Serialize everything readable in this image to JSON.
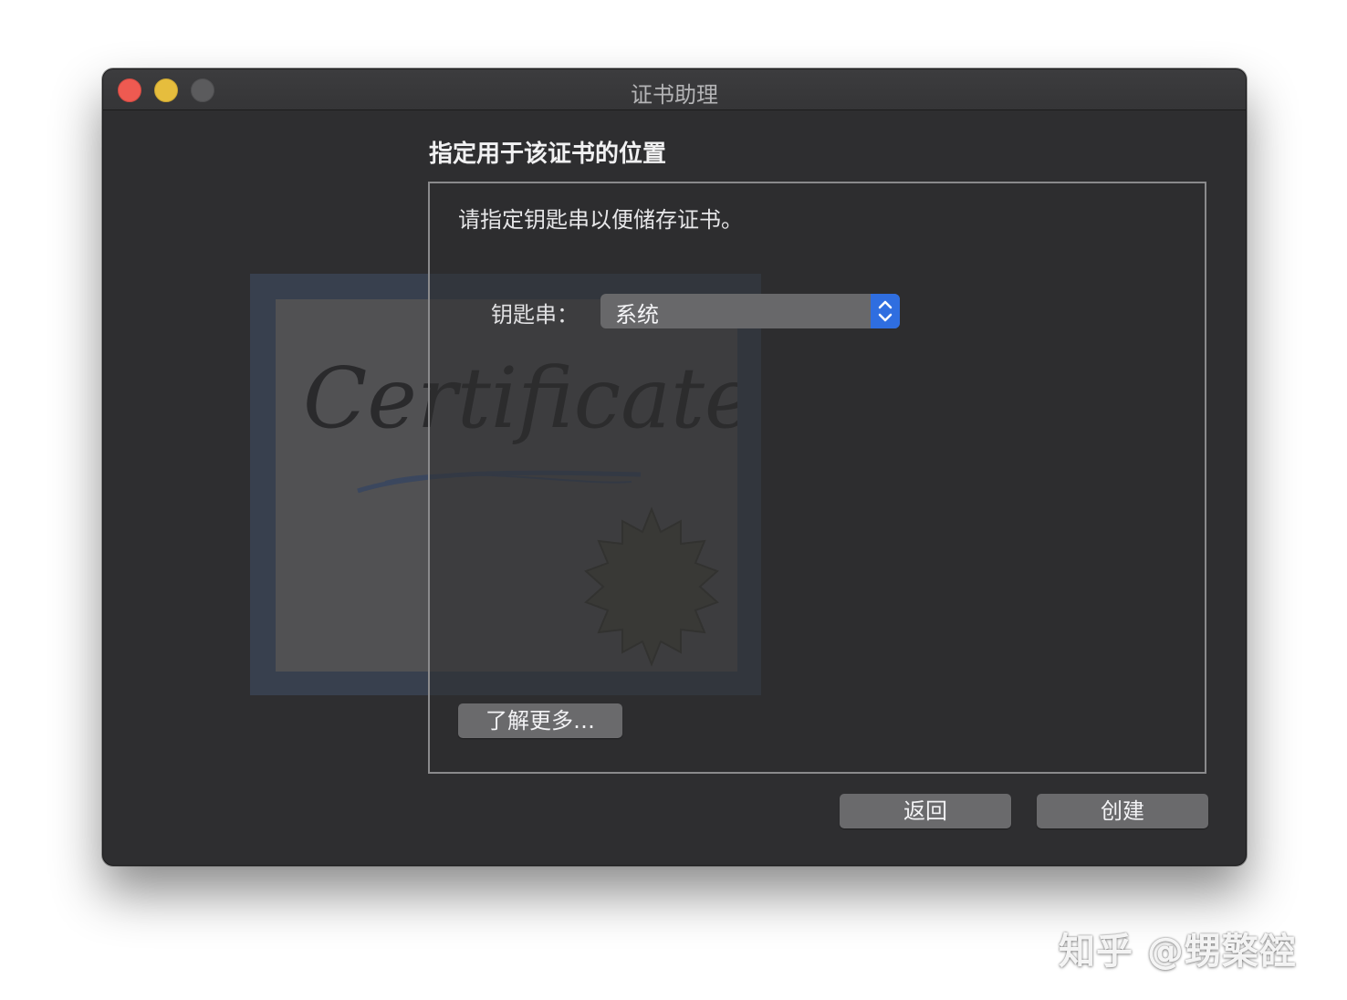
{
  "window": {
    "title": "证书助理"
  },
  "assistant": {
    "heading": "指定用于该证书的位置",
    "instruction": "请指定钥匙串以便储存证书。",
    "keychain_label": "钥匙串：",
    "keychain_value": "系统",
    "learn_more_label": "了解更多…",
    "art_text": "Certificate"
  },
  "footer": {
    "back_label": "返回",
    "create_label": "创建"
  },
  "overlay": {
    "watermark": "知乎 @甥檠谾"
  },
  "icons": {
    "close": "close-icon",
    "minimize": "minimize-icon",
    "zoom": "zoom-icon",
    "stepper": "up-down-chevron-icon",
    "certificate": "certificate-icon"
  },
  "colors": {
    "window_bg": "#2e2e30",
    "close": "#ee5a51",
    "minimize": "#e6bd3d",
    "zoom_disabled": "#5b5b5d",
    "accent": "#2f6ee0"
  }
}
